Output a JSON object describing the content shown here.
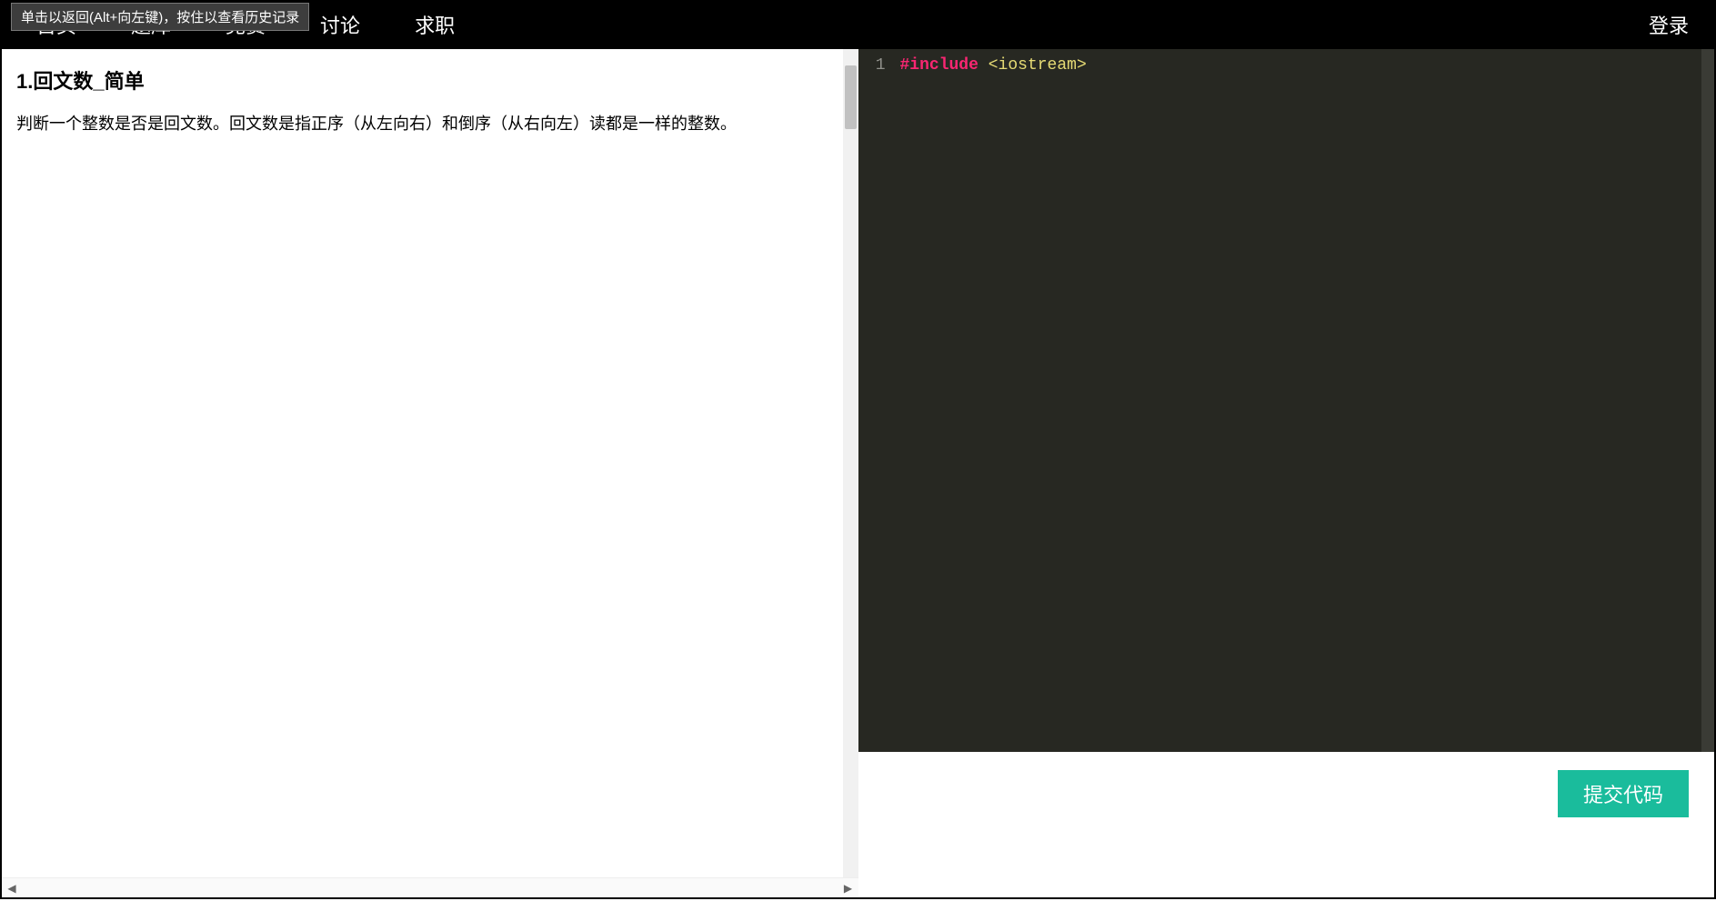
{
  "tooltip": "单击以返回(Alt+向左键)，按住以查看历史记录",
  "nav": {
    "items": [
      "首页",
      "题库",
      "竞赛",
      "讨论",
      "求职"
    ],
    "login": "登录"
  },
  "problem": {
    "title": "1.回文数_简单",
    "description": "判断一个整数是否是回文数。回文数是指正序（从左向右）和倒序（从右向左）读都是一样的整数。"
  },
  "editor": {
    "lines": [
      {
        "n": "1",
        "tokens": [
          {
            "cls": "tok-keyword",
            "text": "#include"
          },
          {
            "cls": "",
            "text": " "
          },
          {
            "cls": "tok-include",
            "text": "<iostream>"
          }
        ]
      }
    ]
  },
  "actions": {
    "submit": "提交代码"
  }
}
